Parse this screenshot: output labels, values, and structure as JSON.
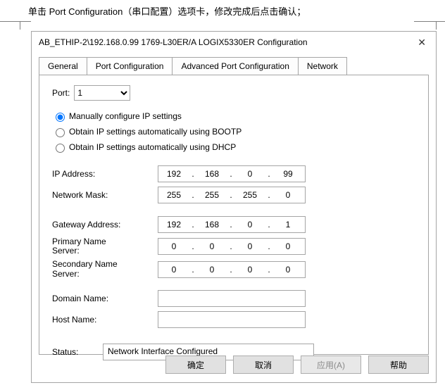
{
  "instruction": "单击 Port Configuration（串口配置）选项卡，修改完成后点击确认；",
  "window": {
    "title": "AB_ETHIP-2\\192.168.0.99 1769-L30ER/A LOGIX5330ER Configuration"
  },
  "tabs": {
    "general": "General",
    "portconfig": "Port Configuration",
    "advanced": "Advanced Port Configuration",
    "network": "Network"
  },
  "portfield": {
    "label": "Port:",
    "value": "1"
  },
  "radios": {
    "manual": "Manually configure IP settings",
    "bootp": "Obtain IP settings automatically using BOOTP",
    "dhcp": "Obtain IP settings automatically using DHCP"
  },
  "labels": {
    "ip": "IP Address:",
    "mask": "Network Mask:",
    "gateway": "Gateway Address:",
    "dns1a": "Primary Name",
    "dns1b": "Server:",
    "dns2a": "Secondary Name",
    "dns2b": "Server:",
    "domain": "Domain Name:",
    "host": "Host Name:",
    "status": "Status:"
  },
  "ip": {
    "o1": "192",
    "o2": "168",
    "o3": "0",
    "o4": "99"
  },
  "mask": {
    "o1": "255",
    "o2": "255",
    "o3": "255",
    "o4": "0"
  },
  "gateway": {
    "o1": "192",
    "o2": "168",
    "o3": "0",
    "o4": "1"
  },
  "dns1": {
    "o1": "0",
    "o2": "0",
    "o3": "0",
    "o4": "0"
  },
  "dns2": {
    "o1": "0",
    "o2": "0",
    "o3": "0",
    "o4": "0"
  },
  "domain": {
    "value": ""
  },
  "host": {
    "value": ""
  },
  "status": {
    "value": "Network Interface Configured"
  },
  "buttons": {
    "ok": "确定",
    "cancel": "取消",
    "apply": "应用(A)",
    "help": "帮助"
  }
}
